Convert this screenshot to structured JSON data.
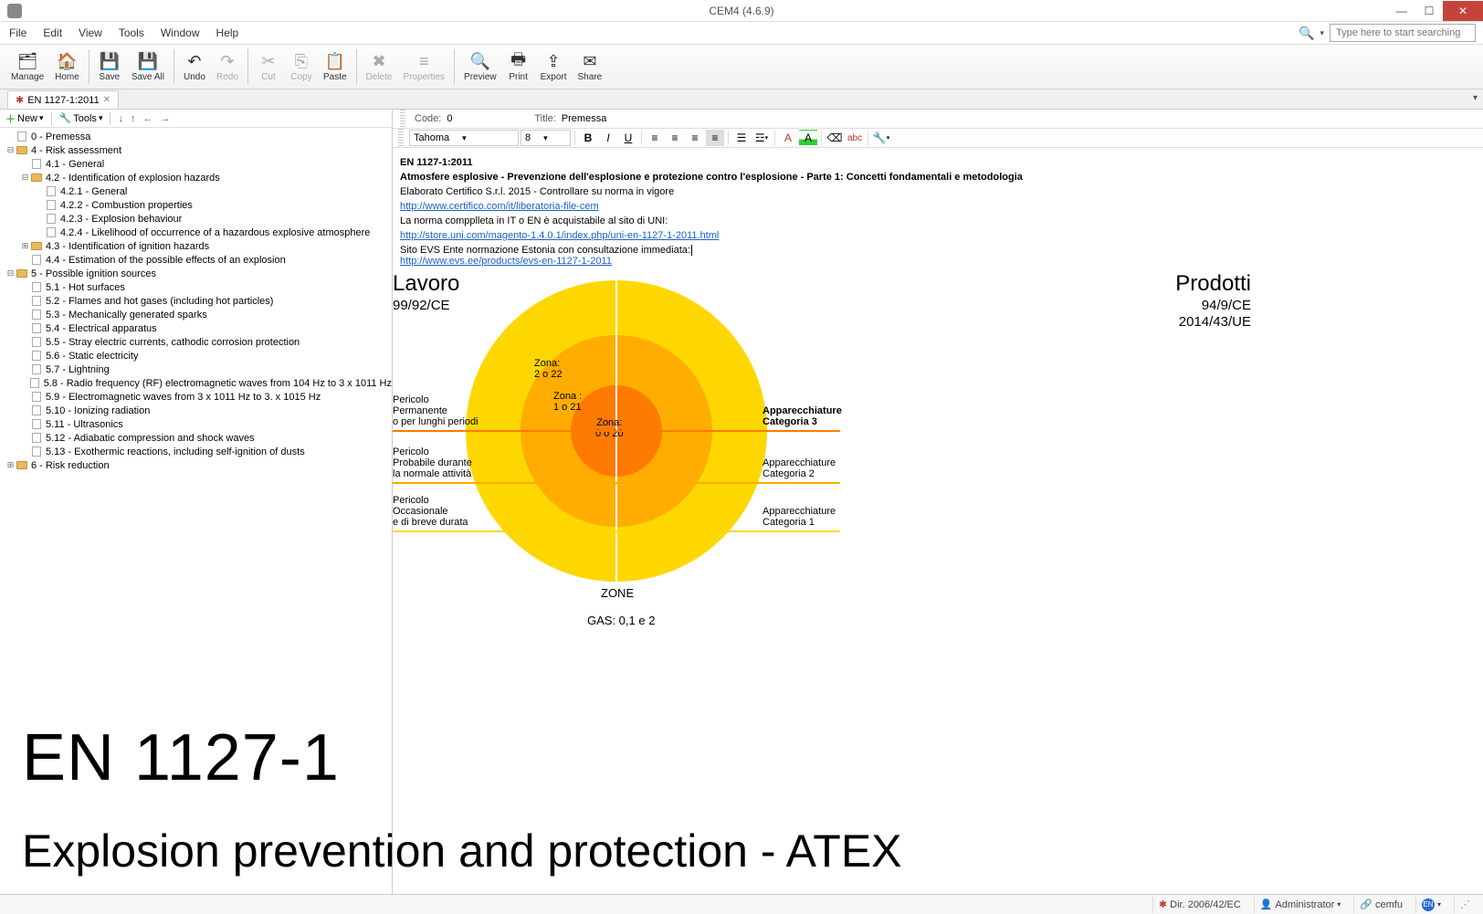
{
  "window": {
    "title": "CEM4 (4.6.9)"
  },
  "menu": [
    "File",
    "Edit",
    "View",
    "Tools",
    "Window",
    "Help"
  ],
  "search": {
    "placeholder": "Type here to start searching"
  },
  "toolbar": [
    {
      "id": "manage",
      "label": "Manage",
      "icon": "🗂"
    },
    {
      "id": "home",
      "label": "Home",
      "icon": "🏠"
    },
    {
      "sep": true
    },
    {
      "id": "save",
      "label": "Save",
      "icon": "💾"
    },
    {
      "id": "saveall",
      "label": "Save All",
      "icon": "💾"
    },
    {
      "sep": true
    },
    {
      "id": "undo",
      "label": "Undo",
      "icon": "↶"
    },
    {
      "id": "redo",
      "label": "Redo",
      "icon": "↷",
      "disabled": true
    },
    {
      "sep": true
    },
    {
      "id": "cut",
      "label": "Cut",
      "icon": "✂",
      "disabled": true
    },
    {
      "id": "copy",
      "label": "Copy",
      "icon": "⎘",
      "disabled": true
    },
    {
      "id": "paste",
      "label": "Paste",
      "icon": "📋"
    },
    {
      "sep": true
    },
    {
      "id": "delete",
      "label": "Delete",
      "icon": "✖",
      "disabled": true
    },
    {
      "id": "properties",
      "label": "Properties",
      "icon": "≡",
      "disabled": true
    },
    {
      "sep": true
    },
    {
      "id": "preview",
      "label": "Preview",
      "icon": "🔍"
    },
    {
      "id": "print",
      "label": "Print",
      "icon": "🖶"
    },
    {
      "id": "export",
      "label": "Export",
      "icon": "⇪"
    },
    {
      "id": "share",
      "label": "Share",
      "icon": "✉"
    }
  ],
  "tab": {
    "label": "EN 1127-1:2011"
  },
  "tree_toolbar": {
    "new": "New",
    "tools": "Tools"
  },
  "tree": [
    {
      "depth": 0,
      "toggle": "",
      "type": "doc",
      "label": "0 - Premessa"
    },
    {
      "depth": 0,
      "toggle": "−",
      "type": "folder",
      "label": "4 - Risk assessment"
    },
    {
      "depth": 1,
      "toggle": "",
      "type": "doc",
      "label": "4.1 - General"
    },
    {
      "depth": 1,
      "toggle": "−",
      "type": "folder",
      "label": "4.2 - Identification of explosion hazards"
    },
    {
      "depth": 2,
      "toggle": "",
      "type": "doc",
      "label": "4.2.1 - General"
    },
    {
      "depth": 2,
      "toggle": "",
      "type": "doc",
      "label": "4.2.2 - Combustion properties"
    },
    {
      "depth": 2,
      "toggle": "",
      "type": "doc",
      "label": "4.2.3 - Explosion behaviour"
    },
    {
      "depth": 2,
      "toggle": "",
      "type": "doc",
      "label": "4.2.4 - Likelihood of occurrence of a hazardous explosive atmosphere"
    },
    {
      "depth": 1,
      "toggle": "+",
      "type": "folder",
      "label": "4.3 - Identification of ignition hazards"
    },
    {
      "depth": 1,
      "toggle": "",
      "type": "doc",
      "label": "4.4 - Estimation of the possible effects of an explosion"
    },
    {
      "depth": 0,
      "toggle": "−",
      "type": "folder",
      "label": "5 - Possible ignition sources"
    },
    {
      "depth": 1,
      "toggle": "",
      "type": "doc",
      "label": "5.1 - Hot surfaces"
    },
    {
      "depth": 1,
      "toggle": "",
      "type": "doc",
      "label": "5.2 - Flames and hot gases (including hot particles)"
    },
    {
      "depth": 1,
      "toggle": "",
      "type": "doc",
      "label": "5.3 - Mechanically generated sparks"
    },
    {
      "depth": 1,
      "toggle": "",
      "type": "doc",
      "label": "5.4 - Electrical apparatus"
    },
    {
      "depth": 1,
      "toggle": "",
      "type": "doc",
      "label": "5.5 - Stray electric currents, cathodic corrosion protection"
    },
    {
      "depth": 1,
      "toggle": "",
      "type": "doc",
      "label": "5.6 - Static electricity"
    },
    {
      "depth": 1,
      "toggle": "",
      "type": "doc",
      "label": "5.7 - Lightning"
    },
    {
      "depth": 1,
      "toggle": "",
      "type": "doc",
      "label": "5.8 - Radio frequency (RF) electromagnetic waves from 104 Hz to 3 x 1011 Hz"
    },
    {
      "depth": 1,
      "toggle": "",
      "type": "doc",
      "label": "5.9 - Electromagnetic waves from 3 x 1011 Hz to 3. x 1015 Hz"
    },
    {
      "depth": 1,
      "toggle": "",
      "type": "doc",
      "label": "5.10 - Ionizing radiation"
    },
    {
      "depth": 1,
      "toggle": "",
      "type": "doc",
      "label": "5.11 - Ultrasonics"
    },
    {
      "depth": 1,
      "toggle": "",
      "type": "doc",
      "label": "5.12 - Adiabatic compression and shock waves"
    },
    {
      "depth": 1,
      "toggle": "",
      "type": "doc",
      "label": "5.13 - Exothermic reactions, including self-ignition of dusts"
    },
    {
      "depth": 0,
      "toggle": "+",
      "type": "folder",
      "label": "6 - Risk reduction"
    }
  ],
  "props": {
    "code_label": "Code:",
    "code_value": "0",
    "title_label": "Title:",
    "title_value": "Premessa"
  },
  "rte": {
    "font": "Tahoma",
    "size": "8"
  },
  "doc": {
    "heading1": "EN 1127-1:2011",
    "heading2": "Atmosfere esplosive - Prevenzione dell'esplosione e protezione contro l'esplosione - Parte 1: Concetti fondamentali e metodologia",
    "line1": "Elaborato Certifico S.r.l. 2015 - Controllare su norma in vigore",
    "link1": "http://www.certifico.com/it/liberatoria-file-cem",
    "line2": "La norma compplleta in IT o EN è acquistabile al sito di UNI:",
    "link2": "http://store.uni.com/magento-1.4.0.1/index.php/uni-en-1127-1-2011.html",
    "line3": "Sito EVS Ente normazione Estonia con consultazione immediata:",
    "link3": "http://www.evs.ee/products/evs-en-1127-1-2011"
  },
  "diagram": {
    "left_title": "Lavoro",
    "left_sub": "99/92/CE",
    "right_title": "Prodotti",
    "right_sub1": "94/9/CE",
    "right_sub2": "2014/43/UE",
    "zone2_a": "Zona:",
    "zone2_b": "2 o 22",
    "zone1_a": "Zona :",
    "zone1_b": "1 o 21",
    "zone0_a": "Zona:",
    "zone0_b": "0 o 20",
    "l1_a": "Pericolo",
    "l1_b": "Permanente",
    "l1_c": "o per lunghi periodi",
    "l2_a": "Pericolo",
    "l2_b": "Probabile durante",
    "l2_c": "la normale attività",
    "l3_a": "Pericolo",
    "l3_b": "Occasionale",
    "l3_c": "e di breve durata",
    "r1_a": "Apparecchiature",
    "r1_b": "Categoria 3",
    "r2_a": "Apparecchiature",
    "r2_b": "Categoria 2",
    "r3_a": "Apparecchiature",
    "r3_b": "Categoria 1",
    "zone_label": "ZONE",
    "gas_label": "GAS: 0,1 e 2"
  },
  "overlay": {
    "title": "EN 1127-1",
    "subtitle": "Explosion prevention and protection - ATEX"
  },
  "status": {
    "dir": "Dir. 2006/42/EC",
    "user": "Administrator",
    "db": "cemfu"
  }
}
